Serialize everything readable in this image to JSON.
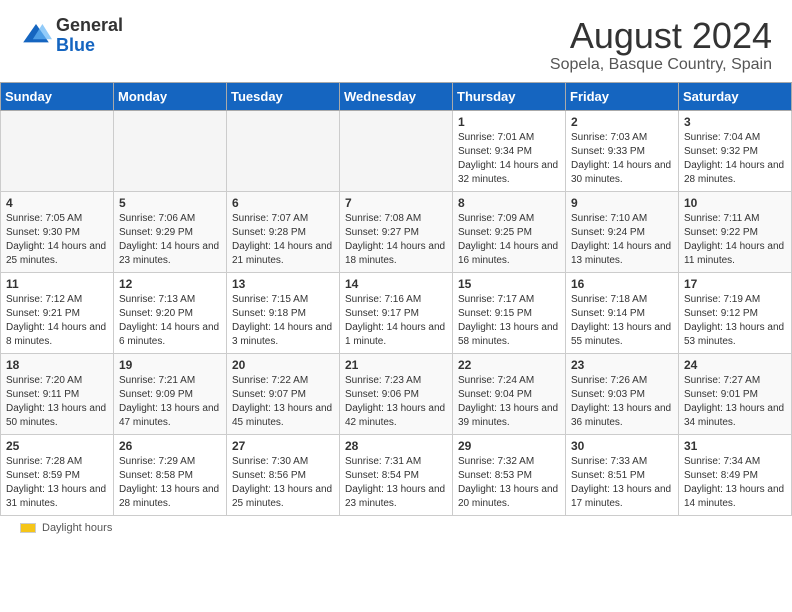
{
  "header": {
    "logo_general": "General",
    "logo_blue": "Blue",
    "title": "August 2024",
    "subtitle": "Sopela, Basque Country, Spain"
  },
  "weekdays": [
    "Sunday",
    "Monday",
    "Tuesday",
    "Wednesday",
    "Thursday",
    "Friday",
    "Saturday"
  ],
  "weeks": [
    [
      {
        "day": "",
        "empty": true
      },
      {
        "day": "",
        "empty": true
      },
      {
        "day": "",
        "empty": true
      },
      {
        "day": "",
        "empty": true
      },
      {
        "day": "1",
        "sunrise": "7:01 AM",
        "sunset": "9:34 PM",
        "daylight": "14 hours and 32 minutes."
      },
      {
        "day": "2",
        "sunrise": "7:03 AM",
        "sunset": "9:33 PM",
        "daylight": "14 hours and 30 minutes."
      },
      {
        "day": "3",
        "sunrise": "7:04 AM",
        "sunset": "9:32 PM",
        "daylight": "14 hours and 28 minutes."
      }
    ],
    [
      {
        "day": "4",
        "sunrise": "7:05 AM",
        "sunset": "9:30 PM",
        "daylight": "14 hours and 25 minutes."
      },
      {
        "day": "5",
        "sunrise": "7:06 AM",
        "sunset": "9:29 PM",
        "daylight": "14 hours and 23 minutes."
      },
      {
        "day": "6",
        "sunrise": "7:07 AM",
        "sunset": "9:28 PM",
        "daylight": "14 hours and 21 minutes."
      },
      {
        "day": "7",
        "sunrise": "7:08 AM",
        "sunset": "9:27 PM",
        "daylight": "14 hours and 18 minutes."
      },
      {
        "day": "8",
        "sunrise": "7:09 AM",
        "sunset": "9:25 PM",
        "daylight": "14 hours and 16 minutes."
      },
      {
        "day": "9",
        "sunrise": "7:10 AM",
        "sunset": "9:24 PM",
        "daylight": "14 hours and 13 minutes."
      },
      {
        "day": "10",
        "sunrise": "7:11 AM",
        "sunset": "9:22 PM",
        "daylight": "14 hours and 11 minutes."
      }
    ],
    [
      {
        "day": "11",
        "sunrise": "7:12 AM",
        "sunset": "9:21 PM",
        "daylight": "14 hours and 8 minutes."
      },
      {
        "day": "12",
        "sunrise": "7:13 AM",
        "sunset": "9:20 PM",
        "daylight": "14 hours and 6 minutes."
      },
      {
        "day": "13",
        "sunrise": "7:15 AM",
        "sunset": "9:18 PM",
        "daylight": "14 hours and 3 minutes."
      },
      {
        "day": "14",
        "sunrise": "7:16 AM",
        "sunset": "9:17 PM",
        "daylight": "14 hours and 1 minute."
      },
      {
        "day": "15",
        "sunrise": "7:17 AM",
        "sunset": "9:15 PM",
        "daylight": "13 hours and 58 minutes."
      },
      {
        "day": "16",
        "sunrise": "7:18 AM",
        "sunset": "9:14 PM",
        "daylight": "13 hours and 55 minutes."
      },
      {
        "day": "17",
        "sunrise": "7:19 AM",
        "sunset": "9:12 PM",
        "daylight": "13 hours and 53 minutes."
      }
    ],
    [
      {
        "day": "18",
        "sunrise": "7:20 AM",
        "sunset": "9:11 PM",
        "daylight": "13 hours and 50 minutes."
      },
      {
        "day": "19",
        "sunrise": "7:21 AM",
        "sunset": "9:09 PM",
        "daylight": "13 hours and 47 minutes."
      },
      {
        "day": "20",
        "sunrise": "7:22 AM",
        "sunset": "9:07 PM",
        "daylight": "13 hours and 45 minutes."
      },
      {
        "day": "21",
        "sunrise": "7:23 AM",
        "sunset": "9:06 PM",
        "daylight": "13 hours and 42 minutes."
      },
      {
        "day": "22",
        "sunrise": "7:24 AM",
        "sunset": "9:04 PM",
        "daylight": "13 hours and 39 minutes."
      },
      {
        "day": "23",
        "sunrise": "7:26 AM",
        "sunset": "9:03 PM",
        "daylight": "13 hours and 36 minutes."
      },
      {
        "day": "24",
        "sunrise": "7:27 AM",
        "sunset": "9:01 PM",
        "daylight": "13 hours and 34 minutes."
      }
    ],
    [
      {
        "day": "25",
        "sunrise": "7:28 AM",
        "sunset": "8:59 PM",
        "daylight": "13 hours and 31 minutes."
      },
      {
        "day": "26",
        "sunrise": "7:29 AM",
        "sunset": "8:58 PM",
        "daylight": "13 hours and 28 minutes."
      },
      {
        "day": "27",
        "sunrise": "7:30 AM",
        "sunset": "8:56 PM",
        "daylight": "13 hours and 25 minutes."
      },
      {
        "day": "28",
        "sunrise": "7:31 AM",
        "sunset": "8:54 PM",
        "daylight": "13 hours and 23 minutes."
      },
      {
        "day": "29",
        "sunrise": "7:32 AM",
        "sunset": "8:53 PM",
        "daylight": "13 hours and 20 minutes."
      },
      {
        "day": "30",
        "sunrise": "7:33 AM",
        "sunset": "8:51 PM",
        "daylight": "13 hours and 17 minutes."
      },
      {
        "day": "31",
        "sunrise": "7:34 AM",
        "sunset": "8:49 PM",
        "daylight": "13 hours and 14 minutes."
      }
    ]
  ],
  "legend": {
    "daylight_label": "Daylight hours"
  }
}
